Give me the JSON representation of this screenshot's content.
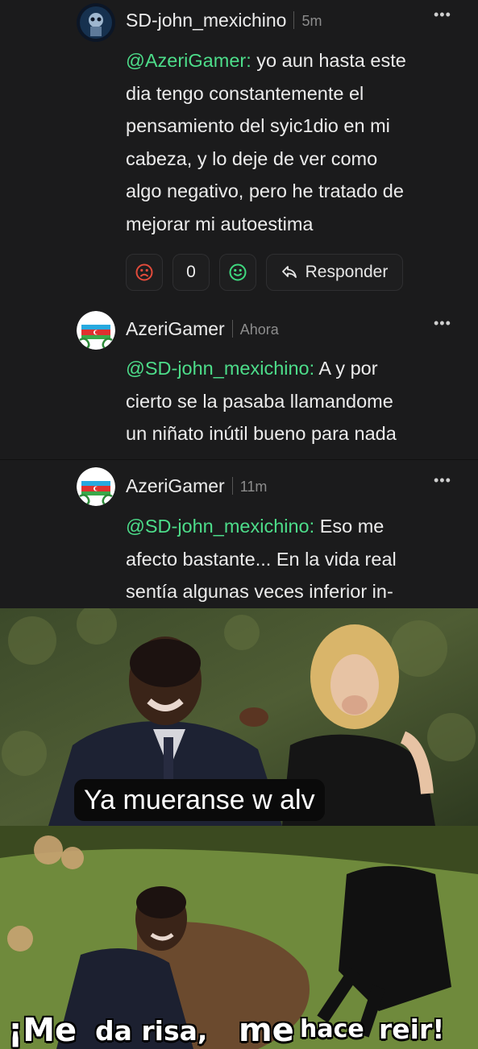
{
  "comments": [
    {
      "username": "SD-john_mexichino",
      "time": "5m",
      "more": "•••",
      "mention": "@AzeriGamer:",
      "lines": [
        "yo aun hasta este",
        "dia tengo constantemente el",
        "pensamiento del syic1dio en mi",
        "cabeza, y lo deje de ver como",
        "algo negativo, pero he tratado de",
        "mejorar mi autoestima"
      ],
      "reactions": {
        "count": "0",
        "reply_label": "Responder"
      }
    },
    {
      "username": "AzeriGamer",
      "time": "Ahora",
      "more": "•••",
      "mention": "@SD-john_mexichino:",
      "lines": [
        "A y por",
        "cierto se la pasaba llamandome",
        "un niñato inútil bueno para nada"
      ]
    },
    {
      "username": "AzeriGamer",
      "time": "11m",
      "more": "•••",
      "mention": "@SD-john_mexichino:",
      "lines": [
        "Eso me",
        "afecto bastante... En la vida real",
        "sentía algunas veces inferior in-"
      ]
    }
  ],
  "meme": {
    "caption_top": "Ya mueranse w alv",
    "caption_bottom": [
      "¡Me",
      "da risa,",
      "me",
      "hace",
      "reir!"
    ]
  },
  "colors": {
    "background": "#1b1b1c",
    "mention": "#4ddd8a",
    "dislike": "#e24b3b",
    "like": "#3fd97f"
  }
}
